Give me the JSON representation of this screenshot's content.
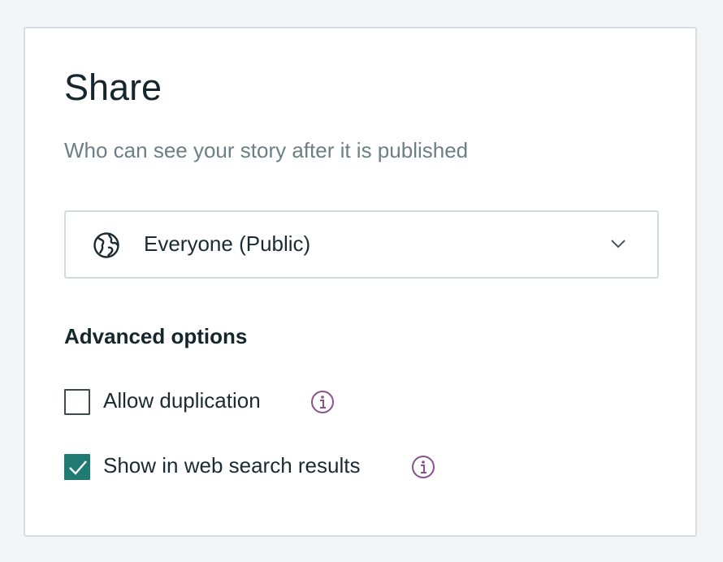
{
  "share": {
    "title": "Share",
    "subtitle": "Who can see your story after it is published"
  },
  "audience": {
    "selected": "Everyone (Public)",
    "icon": "globe-icon"
  },
  "advanced": {
    "heading": "Advanced options",
    "options": [
      {
        "label": "Allow duplication",
        "checked": false,
        "icon": "info-icon"
      },
      {
        "label": "Show in web search results",
        "checked": true,
        "icon": "info-icon"
      }
    ]
  },
  "colors": {
    "accent": "#1f7a74",
    "info": "#8b4f8f"
  }
}
